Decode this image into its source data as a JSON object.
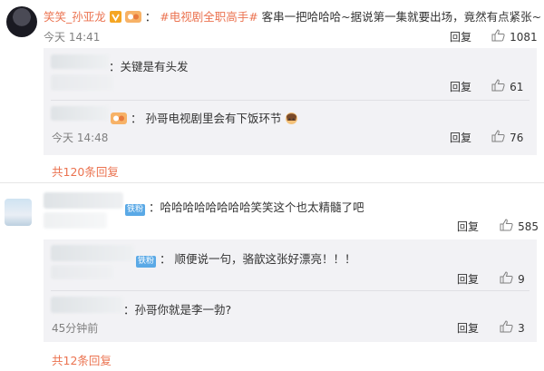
{
  "colors": {
    "accent": "#eb7350",
    "sub_bg": "#f2f2f5",
    "verified": "#f5a623"
  },
  "comment1": {
    "author": "笑笑_孙亚龙",
    "topic": "#电视剧全职高手#",
    "text": "客串一把哈哈哈~据说第一集就要出场，竟然有点紧张~",
    "time": "今天 14:41",
    "reply_label": "回复",
    "likes": "1081",
    "replies": [
      {
        "text": "：关键是有头发",
        "reply_label": "回复",
        "likes": "61"
      },
      {
        "text": "孙哥电视剧里会有下饭环节",
        "time": "今天 14:48",
        "reply_label": "回复",
        "likes": "76"
      }
    ],
    "more": "共120条回复"
  },
  "comment2": {
    "badge": "铁粉",
    "text": "：哈哈哈哈哈哈哈哈笑笑这个也太精髓了吧",
    "reply_label": "回复",
    "likes": "585",
    "replies": [
      {
        "badge": "铁粉",
        "text": "：  顺便说一句，骆歆这张好漂亮！！！",
        "reply_label": "回复",
        "likes": "9"
      },
      {
        "text": "：孙哥你就是李一勃?",
        "time": "45分钟前",
        "reply_label": "回复",
        "likes": "3"
      }
    ],
    "more": "共12条回复"
  }
}
